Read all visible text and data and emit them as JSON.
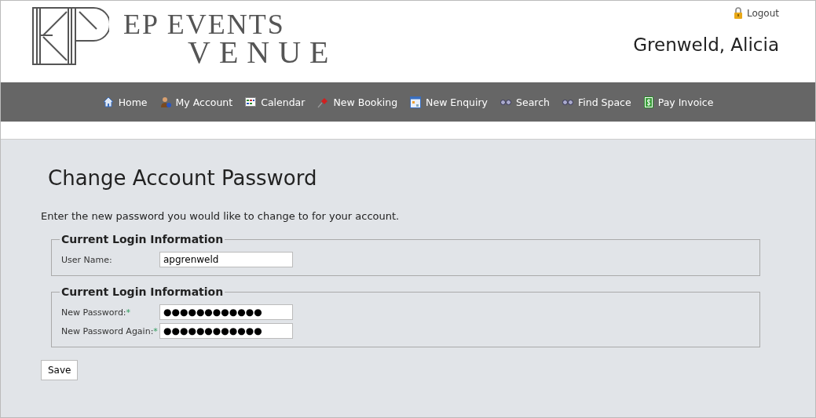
{
  "brand": {
    "line_1": "EP EVENTS",
    "line_2": "VENUE"
  },
  "header": {
    "logout": "Logout",
    "user_name": "Grenweld, Alicia"
  },
  "nav": [
    {
      "label": "Home",
      "kind": "home"
    },
    {
      "label": "My Account",
      "kind": "account"
    },
    {
      "label": "Calendar",
      "kind": "calendar"
    },
    {
      "label": "New Booking",
      "kind": "pin"
    },
    {
      "label": "New Enquiry",
      "kind": "enquiry"
    },
    {
      "label": "Search",
      "kind": "binoculars"
    },
    {
      "label": "Find Space",
      "kind": "binoculars"
    },
    {
      "label": "Pay Invoice",
      "kind": "dollar"
    }
  ],
  "page": {
    "title": "Change Account Password",
    "intro": "Enter the new password you would like to change to for your account."
  },
  "fieldsets": [
    {
      "legend": "Current Login Information",
      "fields": [
        {
          "label": "User Name:",
          "value": "apgrenweld"
        }
      ]
    },
    {
      "legend": "Current Login Information",
      "fields": [
        {
          "label": "New Password:",
          "required_mark": "*",
          "value": "●●●●●●●●●●●●"
        },
        {
          "label": "New Password Again:",
          "required_mark": "*",
          "value": "●●●●●●●●●●●●"
        }
      ]
    }
  ],
  "save_button": "Save"
}
